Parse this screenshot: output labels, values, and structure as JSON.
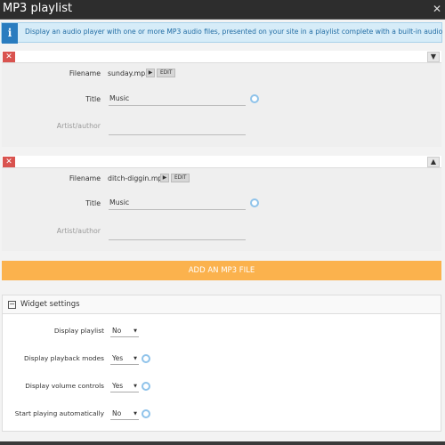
{
  "window": {
    "title": "MP3 playlist",
    "close_glyph": "✕"
  },
  "info": {
    "icon_glyph": "i",
    "text": "Display an audio player with one or more MP3 audio files, presented on your site in a playlist complete with a built-in audio player."
  },
  "items": [
    {
      "remove_glyph": "✕",
      "move_glyph": "▼",
      "filename_label": "Filename",
      "filename": "sunday.mp3",
      "play_glyph": "▶",
      "edit_label": "EDIT",
      "title_label": "Title",
      "title_value": "Music",
      "artist_label": "Artist/author",
      "artist_value": ""
    },
    {
      "remove_glyph": "✕",
      "move_glyph": "▲",
      "filename_label": "Filename",
      "filename": "ditch-diggin.mp3",
      "play_glyph": "▶",
      "edit_label": "EDIT",
      "title_label": "Title",
      "title_value": "Music",
      "artist_label": "Artist/author",
      "artist_value": ""
    }
  ],
  "add_button": "ADD AN MP3 FILE",
  "widget_settings": {
    "collapse_glyph": "−",
    "title": "Widget settings",
    "settings": [
      {
        "label": "Display playlist",
        "value": "No"
      },
      {
        "label": "Display playback modes",
        "value": "Yes"
      },
      {
        "label": "Display volume controls",
        "value": "Yes"
      },
      {
        "label": "Start playing automatically",
        "value": "No"
      }
    ],
    "caret_glyph": "▼"
  },
  "colors": {
    "accent_orange": "#fbb24d",
    "info_blue": "#2a7cbf",
    "remove_red": "#d9534f",
    "help_blue": "#8fc3ea"
  }
}
